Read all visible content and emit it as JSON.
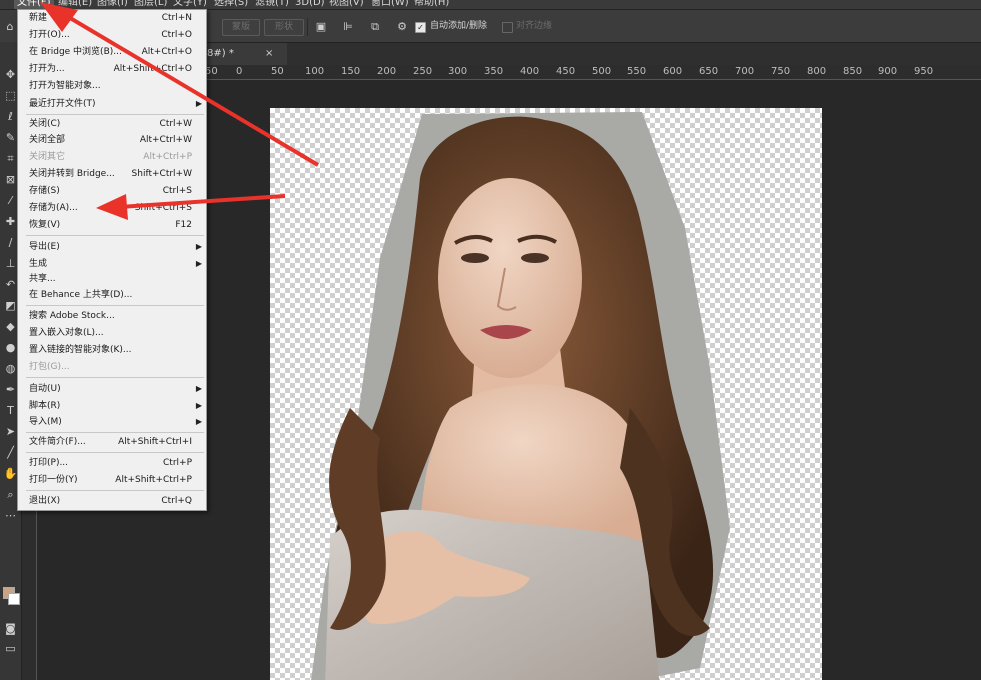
{
  "menubar": {
    "items": [
      "文件(F)",
      "编辑(E)",
      "图像(I)",
      "图层(L)",
      "文字(Y)",
      "选择(S)",
      "滤镜(T)",
      "3D(D)",
      "视图(V)",
      "窗口(W)",
      "帮助(H)"
    ]
  },
  "options_bar": {
    "mask_label": "蒙版",
    "shape_label": "形状",
    "auto_add_delete_label": "自动添加/删除",
    "auto_add_delete_checked": true,
    "align_edges_label": "对齐边缘",
    "align_edges_checked": false
  },
  "document_tab": {
    "title": "8#) *",
    "close": "×"
  },
  "ruler": {
    "labels": [
      "50",
      "0",
      "50",
      "100",
      "150",
      "200",
      "250",
      "300",
      "350",
      "400",
      "450",
      "500",
      "550",
      "600",
      "650",
      "700",
      "750",
      "800",
      "850",
      "900",
      "950"
    ]
  },
  "colors": {
    "foreground": "#c9a487",
    "background": "#ffffff",
    "annotation_arrow": "#e8322a"
  },
  "file_menu": {
    "items": [
      {
        "label": "新建",
        "shortcut": "Ctrl+N"
      },
      {
        "label": "打开(O)...",
        "shortcut": "Ctrl+O"
      },
      {
        "label": "在 Bridge 中浏览(B)...",
        "shortcut": "Alt+Ctrl+O"
      },
      {
        "label": "打开为...",
        "shortcut": "Alt+Shift+Ctrl+O"
      },
      {
        "label": "打开为智能对象...",
        "shortcut": ""
      },
      {
        "label": "最近打开文件(T)",
        "shortcut": "",
        "submenu": true
      },
      {
        "label": "关闭(C)",
        "shortcut": "Ctrl+W"
      },
      {
        "label": "关闭全部",
        "shortcut": "Alt+Ctrl+W"
      },
      {
        "label": "关闭其它",
        "shortcut": "Alt+Ctrl+P",
        "disabled": true
      },
      {
        "label": "关闭并转到 Bridge...",
        "shortcut": "Shift+Ctrl+W"
      },
      {
        "label": "存储(S)",
        "shortcut": "Ctrl+S"
      },
      {
        "label": "存储为(A)...",
        "shortcut": "Shift+Ctrl+S"
      },
      {
        "label": "恢复(V)",
        "shortcut": "F12"
      },
      {
        "label": "导出(E)",
        "shortcut": "",
        "submenu": true
      },
      {
        "label": "生成",
        "shortcut": "",
        "submenu": true
      },
      {
        "label": "共享...",
        "shortcut": ""
      },
      {
        "label": "在 Behance 上共享(D)...",
        "shortcut": ""
      },
      {
        "label": "搜索 Adobe Stock...",
        "shortcut": ""
      },
      {
        "label": "置入嵌入对象(L)...",
        "shortcut": ""
      },
      {
        "label": "置入链接的智能对象(K)...",
        "shortcut": ""
      },
      {
        "label": "打包(G)...",
        "shortcut": "",
        "disabled": true
      },
      {
        "label": "自动(U)",
        "shortcut": "",
        "submenu": true
      },
      {
        "label": "脚本(R)",
        "shortcut": "",
        "submenu": true
      },
      {
        "label": "导入(M)",
        "shortcut": "",
        "submenu": true
      },
      {
        "label": "文件简介(F)...",
        "shortcut": "Alt+Shift+Ctrl+I"
      },
      {
        "label": "打印(P)...",
        "shortcut": "Ctrl+P"
      },
      {
        "label": "打印一份(Y)",
        "shortcut": "Alt+Shift+Ctrl+P"
      },
      {
        "label": "退出(X)",
        "shortcut": "Ctrl+Q"
      }
    ]
  },
  "toolbar": {
    "tools": [
      "move-tool",
      "marquee-tool",
      "lasso-tool",
      "quick-select-tool",
      "crop-tool",
      "frame-tool",
      "eyedropper-tool",
      "healing-brush-tool",
      "brush-tool",
      "clone-stamp-tool",
      "history-brush-tool",
      "eraser-tool",
      "paint-bucket-tool",
      "blur-tool",
      "dodge-tool",
      "pen-tool",
      "type-tool",
      "path-select-tool",
      "line-tool",
      "hand-tool",
      "zoom-tool",
      "more-tools"
    ]
  }
}
